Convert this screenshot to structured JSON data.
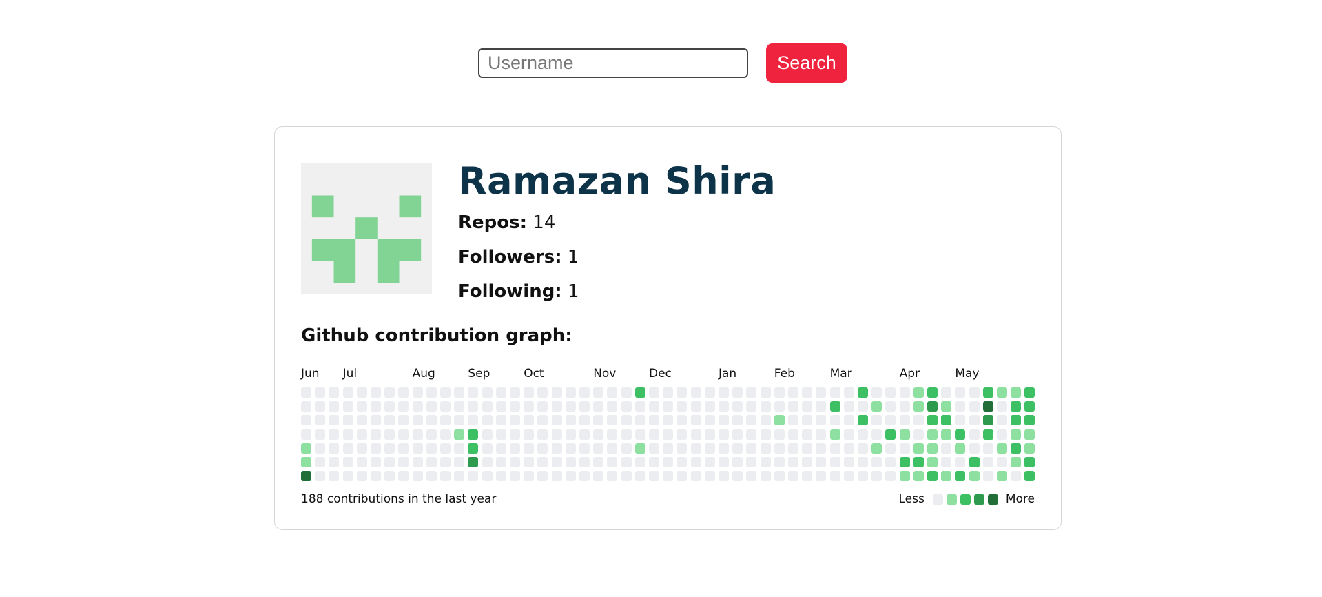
{
  "search": {
    "placeholder": "Username",
    "button_label": "Search"
  },
  "profile": {
    "name": "Ramazan Shira",
    "repos_label": "Repos:",
    "repos": "14",
    "followers_label": "Followers:",
    "followers": "1",
    "following_label": "Following:",
    "following": "1"
  },
  "graph": {
    "title": "Github contribution graph:",
    "months": [
      {
        "label": "Jun",
        "week": 0
      },
      {
        "label": "Jul",
        "week": 3
      },
      {
        "label": "Aug",
        "week": 8
      },
      {
        "label": "Sep",
        "week": 12
      },
      {
        "label": "Oct",
        "week": 16
      },
      {
        "label": "Nov",
        "week": 21
      },
      {
        "label": "Dec",
        "week": 25
      },
      {
        "label": "Jan",
        "week": 30
      },
      {
        "label": "Feb",
        "week": 34
      },
      {
        "label": "Mar",
        "week": 38
      },
      {
        "label": "Apr",
        "week": 43
      },
      {
        "label": "May",
        "week": 47
      }
    ],
    "weeks": 53,
    "days": 7,
    "levels": [
      [
        0,
        4,
        1
      ],
      [
        0,
        5,
        1
      ],
      [
        0,
        6,
        4
      ],
      [
        11,
        3,
        1
      ],
      [
        24,
        0,
        2
      ],
      [
        24,
        4,
        1
      ],
      [
        12,
        3,
        2
      ],
      [
        12,
        4,
        2
      ],
      [
        12,
        5,
        3
      ],
      [
        34,
        2,
        1
      ],
      [
        38,
        1,
        2
      ],
      [
        38,
        3,
        1
      ],
      [
        40,
        0,
        2
      ],
      [
        40,
        2,
        2
      ],
      [
        41,
        1,
        1
      ],
      [
        41,
        4,
        1
      ],
      [
        42,
        3,
        2
      ],
      [
        43,
        3,
        1
      ],
      [
        43,
        5,
        2
      ],
      [
        43,
        6,
        1
      ],
      [
        44,
        0,
        1
      ],
      [
        44,
        1,
        1
      ],
      [
        44,
        4,
        1
      ],
      [
        44,
        5,
        2
      ],
      [
        44,
        6,
        1
      ],
      [
        45,
        0,
        2
      ],
      [
        45,
        1,
        3
      ],
      [
        45,
        2,
        2
      ],
      [
        45,
        3,
        1
      ],
      [
        45,
        4,
        1
      ],
      [
        45,
        5,
        1
      ],
      [
        45,
        6,
        2
      ],
      [
        46,
        1,
        1
      ],
      [
        46,
        2,
        2
      ],
      [
        46,
        3,
        1
      ],
      [
        46,
        6,
        1
      ],
      [
        47,
        3,
        2
      ],
      [
        47,
        4,
        1
      ],
      [
        47,
        6,
        2
      ],
      [
        48,
        5,
        2
      ],
      [
        48,
        6,
        1
      ],
      [
        49,
        0,
        2
      ],
      [
        49,
        1,
        4
      ],
      [
        49,
        2,
        3
      ],
      [
        49,
        3,
        2
      ],
      [
        50,
        0,
        1
      ],
      [
        50,
        4,
        1
      ],
      [
        50,
        6,
        1
      ],
      [
        51,
        0,
        1
      ],
      [
        51,
        1,
        2
      ],
      [
        51,
        2,
        2
      ],
      [
        51,
        3,
        1
      ],
      [
        51,
        4,
        2
      ],
      [
        51,
        5,
        1
      ],
      [
        52,
        0,
        2
      ],
      [
        52,
        1,
        2
      ],
      [
        52,
        2,
        2
      ],
      [
        52,
        3,
        1
      ],
      [
        52,
        4,
        1
      ],
      [
        52,
        5,
        2
      ],
      [
        52,
        6,
        2
      ]
    ],
    "summary": "188 contributions in the last year",
    "legend_less": "Less",
    "legend_more": "More",
    "colors": [
      "#ebedf0",
      "#8ee0a0",
      "#3dbf63",
      "#2e9a4d",
      "#216e39"
    ]
  },
  "avatar_color": "#82d494"
}
